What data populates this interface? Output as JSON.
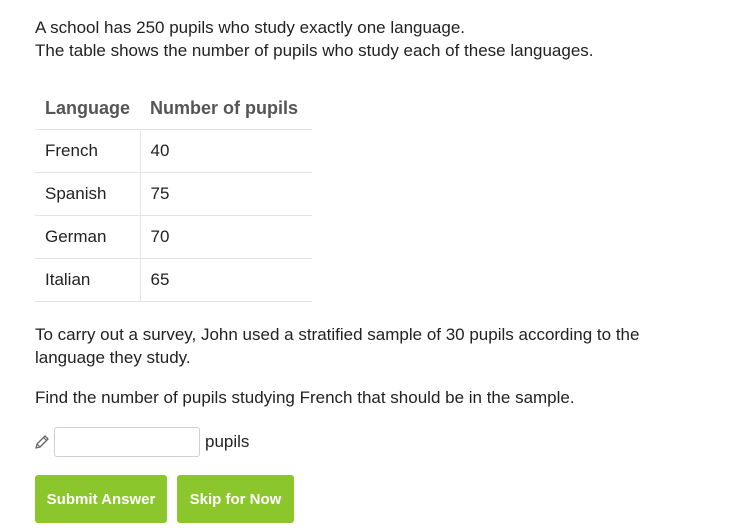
{
  "question": {
    "intro_line1": "A school has 250 pupils who study exactly one language.",
    "intro_line2": "The table shows the number of pupils who study each of these languages.",
    "table": {
      "headers": [
        "Language",
        "Number of pupils"
      ],
      "rows": [
        [
          "French",
          "40"
        ],
        [
          "Spanish",
          "75"
        ],
        [
          "German",
          "70"
        ],
        [
          "Italian",
          "65"
        ]
      ]
    },
    "survey_text": "To carry out a survey, John used a stratified sample of 30 pupils according to the language they study.",
    "prompt": "Find the number of pupils studying French that should be in the sample."
  },
  "answer": {
    "icon": "pencil-icon",
    "value": "",
    "unit": "pupils"
  },
  "buttons": {
    "submit_label": "Submit Answer",
    "skip_label": "Skip for Now"
  },
  "colors": {
    "button_green": "#8cc62d",
    "text": "#222222",
    "header_text": "#555555",
    "border": "#e3e3e3"
  }
}
